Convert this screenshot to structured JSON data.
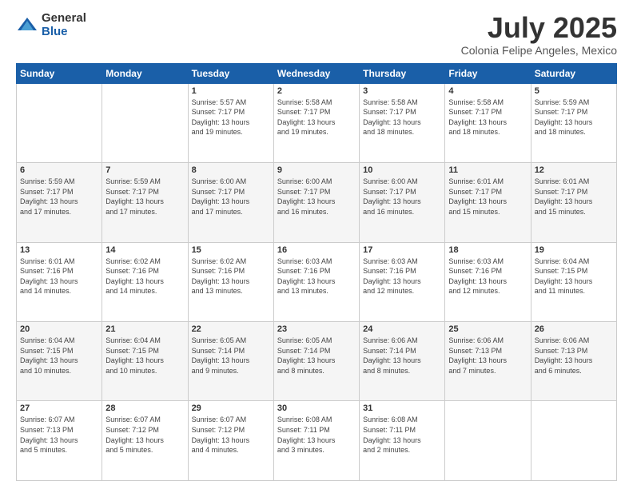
{
  "header": {
    "logo": {
      "general": "General",
      "blue": "Blue"
    },
    "title": "July 2025",
    "subtitle": "Colonia Felipe Angeles, Mexico"
  },
  "weekdays": [
    "Sunday",
    "Monday",
    "Tuesday",
    "Wednesday",
    "Thursday",
    "Friday",
    "Saturday"
  ],
  "weeks": [
    [
      {
        "day": "",
        "info": ""
      },
      {
        "day": "",
        "info": ""
      },
      {
        "day": "1",
        "info": "Sunrise: 5:57 AM\nSunset: 7:17 PM\nDaylight: 13 hours\nand 19 minutes."
      },
      {
        "day": "2",
        "info": "Sunrise: 5:58 AM\nSunset: 7:17 PM\nDaylight: 13 hours\nand 19 minutes."
      },
      {
        "day": "3",
        "info": "Sunrise: 5:58 AM\nSunset: 7:17 PM\nDaylight: 13 hours\nand 18 minutes."
      },
      {
        "day": "4",
        "info": "Sunrise: 5:58 AM\nSunset: 7:17 PM\nDaylight: 13 hours\nand 18 minutes."
      },
      {
        "day": "5",
        "info": "Sunrise: 5:59 AM\nSunset: 7:17 PM\nDaylight: 13 hours\nand 18 minutes."
      }
    ],
    [
      {
        "day": "6",
        "info": "Sunrise: 5:59 AM\nSunset: 7:17 PM\nDaylight: 13 hours\nand 17 minutes."
      },
      {
        "day": "7",
        "info": "Sunrise: 5:59 AM\nSunset: 7:17 PM\nDaylight: 13 hours\nand 17 minutes."
      },
      {
        "day": "8",
        "info": "Sunrise: 6:00 AM\nSunset: 7:17 PM\nDaylight: 13 hours\nand 17 minutes."
      },
      {
        "day": "9",
        "info": "Sunrise: 6:00 AM\nSunset: 7:17 PM\nDaylight: 13 hours\nand 16 minutes."
      },
      {
        "day": "10",
        "info": "Sunrise: 6:00 AM\nSunset: 7:17 PM\nDaylight: 13 hours\nand 16 minutes."
      },
      {
        "day": "11",
        "info": "Sunrise: 6:01 AM\nSunset: 7:17 PM\nDaylight: 13 hours\nand 15 minutes."
      },
      {
        "day": "12",
        "info": "Sunrise: 6:01 AM\nSunset: 7:17 PM\nDaylight: 13 hours\nand 15 minutes."
      }
    ],
    [
      {
        "day": "13",
        "info": "Sunrise: 6:01 AM\nSunset: 7:16 PM\nDaylight: 13 hours\nand 14 minutes."
      },
      {
        "day": "14",
        "info": "Sunrise: 6:02 AM\nSunset: 7:16 PM\nDaylight: 13 hours\nand 14 minutes."
      },
      {
        "day": "15",
        "info": "Sunrise: 6:02 AM\nSunset: 7:16 PM\nDaylight: 13 hours\nand 13 minutes."
      },
      {
        "day": "16",
        "info": "Sunrise: 6:03 AM\nSunset: 7:16 PM\nDaylight: 13 hours\nand 13 minutes."
      },
      {
        "day": "17",
        "info": "Sunrise: 6:03 AM\nSunset: 7:16 PM\nDaylight: 13 hours\nand 12 minutes."
      },
      {
        "day": "18",
        "info": "Sunrise: 6:03 AM\nSunset: 7:16 PM\nDaylight: 13 hours\nand 12 minutes."
      },
      {
        "day": "19",
        "info": "Sunrise: 6:04 AM\nSunset: 7:15 PM\nDaylight: 13 hours\nand 11 minutes."
      }
    ],
    [
      {
        "day": "20",
        "info": "Sunrise: 6:04 AM\nSunset: 7:15 PM\nDaylight: 13 hours\nand 10 minutes."
      },
      {
        "day": "21",
        "info": "Sunrise: 6:04 AM\nSunset: 7:15 PM\nDaylight: 13 hours\nand 10 minutes."
      },
      {
        "day": "22",
        "info": "Sunrise: 6:05 AM\nSunset: 7:14 PM\nDaylight: 13 hours\nand 9 minutes."
      },
      {
        "day": "23",
        "info": "Sunrise: 6:05 AM\nSunset: 7:14 PM\nDaylight: 13 hours\nand 8 minutes."
      },
      {
        "day": "24",
        "info": "Sunrise: 6:06 AM\nSunset: 7:14 PM\nDaylight: 13 hours\nand 8 minutes."
      },
      {
        "day": "25",
        "info": "Sunrise: 6:06 AM\nSunset: 7:13 PM\nDaylight: 13 hours\nand 7 minutes."
      },
      {
        "day": "26",
        "info": "Sunrise: 6:06 AM\nSunset: 7:13 PM\nDaylight: 13 hours\nand 6 minutes."
      }
    ],
    [
      {
        "day": "27",
        "info": "Sunrise: 6:07 AM\nSunset: 7:13 PM\nDaylight: 13 hours\nand 5 minutes."
      },
      {
        "day": "28",
        "info": "Sunrise: 6:07 AM\nSunset: 7:12 PM\nDaylight: 13 hours\nand 5 minutes."
      },
      {
        "day": "29",
        "info": "Sunrise: 6:07 AM\nSunset: 7:12 PM\nDaylight: 13 hours\nand 4 minutes."
      },
      {
        "day": "30",
        "info": "Sunrise: 6:08 AM\nSunset: 7:11 PM\nDaylight: 13 hours\nand 3 minutes."
      },
      {
        "day": "31",
        "info": "Sunrise: 6:08 AM\nSunset: 7:11 PM\nDaylight: 13 hours\nand 2 minutes."
      },
      {
        "day": "",
        "info": ""
      },
      {
        "day": "",
        "info": ""
      }
    ]
  ]
}
